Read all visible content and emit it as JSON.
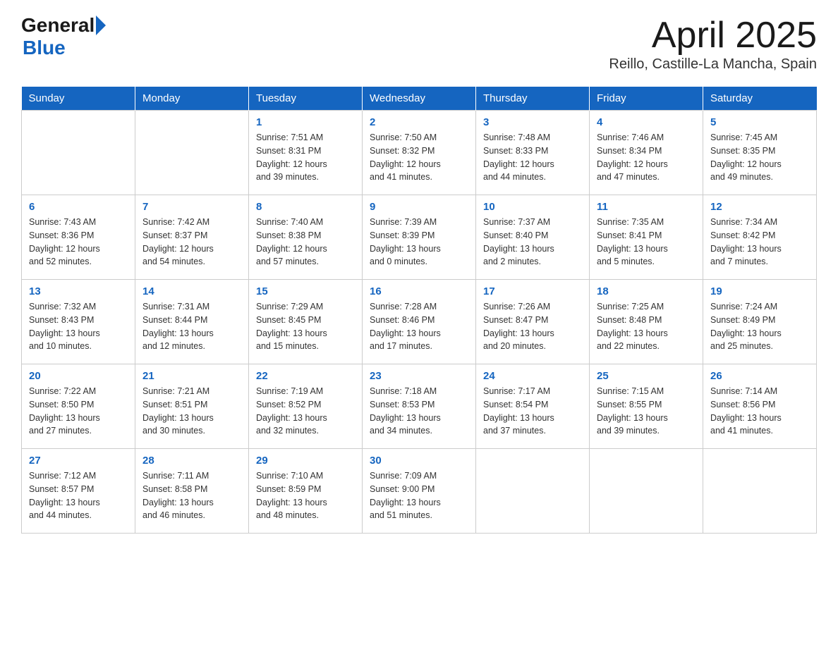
{
  "logo": {
    "general": "General",
    "blue": "Blue"
  },
  "title": "April 2025",
  "location": "Reillo, Castille-La Mancha, Spain",
  "days_of_week": [
    "Sunday",
    "Monday",
    "Tuesday",
    "Wednesday",
    "Thursday",
    "Friday",
    "Saturday"
  ],
  "weeks": [
    [
      {
        "day": "",
        "info": ""
      },
      {
        "day": "",
        "info": ""
      },
      {
        "day": "1",
        "info": "Sunrise: 7:51 AM\nSunset: 8:31 PM\nDaylight: 12 hours\nand 39 minutes."
      },
      {
        "day": "2",
        "info": "Sunrise: 7:50 AM\nSunset: 8:32 PM\nDaylight: 12 hours\nand 41 minutes."
      },
      {
        "day": "3",
        "info": "Sunrise: 7:48 AM\nSunset: 8:33 PM\nDaylight: 12 hours\nand 44 minutes."
      },
      {
        "day": "4",
        "info": "Sunrise: 7:46 AM\nSunset: 8:34 PM\nDaylight: 12 hours\nand 47 minutes."
      },
      {
        "day": "5",
        "info": "Sunrise: 7:45 AM\nSunset: 8:35 PM\nDaylight: 12 hours\nand 49 minutes."
      }
    ],
    [
      {
        "day": "6",
        "info": "Sunrise: 7:43 AM\nSunset: 8:36 PM\nDaylight: 12 hours\nand 52 minutes."
      },
      {
        "day": "7",
        "info": "Sunrise: 7:42 AM\nSunset: 8:37 PM\nDaylight: 12 hours\nand 54 minutes."
      },
      {
        "day": "8",
        "info": "Sunrise: 7:40 AM\nSunset: 8:38 PM\nDaylight: 12 hours\nand 57 minutes."
      },
      {
        "day": "9",
        "info": "Sunrise: 7:39 AM\nSunset: 8:39 PM\nDaylight: 13 hours\nand 0 minutes."
      },
      {
        "day": "10",
        "info": "Sunrise: 7:37 AM\nSunset: 8:40 PM\nDaylight: 13 hours\nand 2 minutes."
      },
      {
        "day": "11",
        "info": "Sunrise: 7:35 AM\nSunset: 8:41 PM\nDaylight: 13 hours\nand 5 minutes."
      },
      {
        "day": "12",
        "info": "Sunrise: 7:34 AM\nSunset: 8:42 PM\nDaylight: 13 hours\nand 7 minutes."
      }
    ],
    [
      {
        "day": "13",
        "info": "Sunrise: 7:32 AM\nSunset: 8:43 PM\nDaylight: 13 hours\nand 10 minutes."
      },
      {
        "day": "14",
        "info": "Sunrise: 7:31 AM\nSunset: 8:44 PM\nDaylight: 13 hours\nand 12 minutes."
      },
      {
        "day": "15",
        "info": "Sunrise: 7:29 AM\nSunset: 8:45 PM\nDaylight: 13 hours\nand 15 minutes."
      },
      {
        "day": "16",
        "info": "Sunrise: 7:28 AM\nSunset: 8:46 PM\nDaylight: 13 hours\nand 17 minutes."
      },
      {
        "day": "17",
        "info": "Sunrise: 7:26 AM\nSunset: 8:47 PM\nDaylight: 13 hours\nand 20 minutes."
      },
      {
        "day": "18",
        "info": "Sunrise: 7:25 AM\nSunset: 8:48 PM\nDaylight: 13 hours\nand 22 minutes."
      },
      {
        "day": "19",
        "info": "Sunrise: 7:24 AM\nSunset: 8:49 PM\nDaylight: 13 hours\nand 25 minutes."
      }
    ],
    [
      {
        "day": "20",
        "info": "Sunrise: 7:22 AM\nSunset: 8:50 PM\nDaylight: 13 hours\nand 27 minutes."
      },
      {
        "day": "21",
        "info": "Sunrise: 7:21 AM\nSunset: 8:51 PM\nDaylight: 13 hours\nand 30 minutes."
      },
      {
        "day": "22",
        "info": "Sunrise: 7:19 AM\nSunset: 8:52 PM\nDaylight: 13 hours\nand 32 minutes."
      },
      {
        "day": "23",
        "info": "Sunrise: 7:18 AM\nSunset: 8:53 PM\nDaylight: 13 hours\nand 34 minutes."
      },
      {
        "day": "24",
        "info": "Sunrise: 7:17 AM\nSunset: 8:54 PM\nDaylight: 13 hours\nand 37 minutes."
      },
      {
        "day": "25",
        "info": "Sunrise: 7:15 AM\nSunset: 8:55 PM\nDaylight: 13 hours\nand 39 minutes."
      },
      {
        "day": "26",
        "info": "Sunrise: 7:14 AM\nSunset: 8:56 PM\nDaylight: 13 hours\nand 41 minutes."
      }
    ],
    [
      {
        "day": "27",
        "info": "Sunrise: 7:12 AM\nSunset: 8:57 PM\nDaylight: 13 hours\nand 44 minutes."
      },
      {
        "day": "28",
        "info": "Sunrise: 7:11 AM\nSunset: 8:58 PM\nDaylight: 13 hours\nand 46 minutes."
      },
      {
        "day": "29",
        "info": "Sunrise: 7:10 AM\nSunset: 8:59 PM\nDaylight: 13 hours\nand 48 minutes."
      },
      {
        "day": "30",
        "info": "Sunrise: 7:09 AM\nSunset: 9:00 PM\nDaylight: 13 hours\nand 51 minutes."
      },
      {
        "day": "",
        "info": ""
      },
      {
        "day": "",
        "info": ""
      },
      {
        "day": "",
        "info": ""
      }
    ]
  ]
}
